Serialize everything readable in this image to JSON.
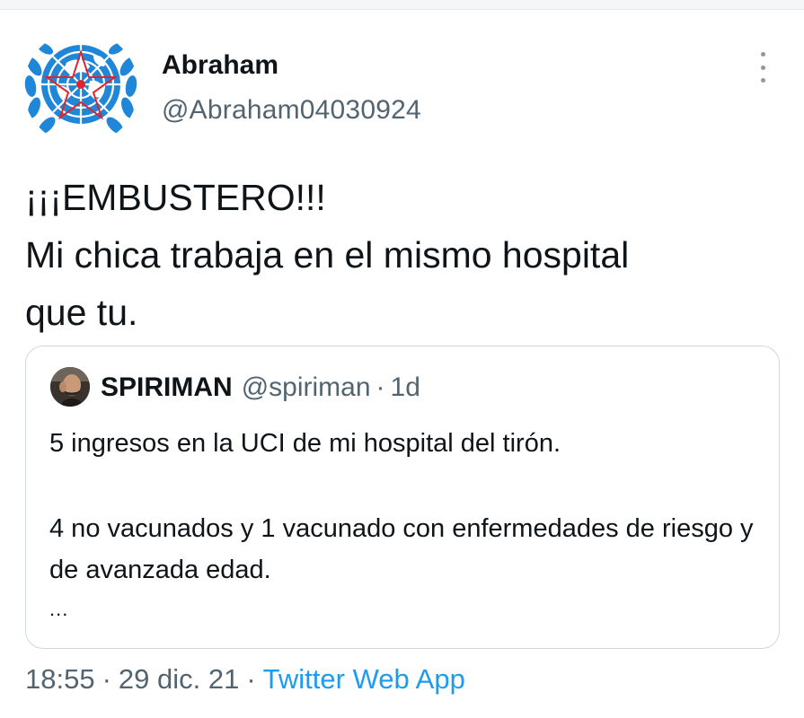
{
  "author": {
    "name": "Abraham",
    "handle": "@Abraham04030924",
    "avatar_icon": "un-emblem-avatar"
  },
  "tweet": {
    "text": "¡¡¡EMBUSTERO!!!\nMi chica trabaja en el mismo hospital\nque tu."
  },
  "quoted": {
    "name": "SPIRIMAN",
    "handle": "@spiriman",
    "separator": "·",
    "time": "1d",
    "line1": "5 ingresos en la UCI de mi hospital del tirón.",
    "line2": "4 no vacunados y 1 vacunado con enfermedades de riesgo y de avanzada edad.",
    "ellipsis": "..."
  },
  "meta": {
    "time": "18:55",
    "sep1": "·",
    "date": "29 dic. 21",
    "sep2": "·",
    "source": "Twitter Web App"
  },
  "colors": {
    "accent": "#1d9bf0",
    "secondary_text": "#536471",
    "avatar_blue": "#1f86d8"
  },
  "icons": {
    "more": "more-vertical-icon"
  }
}
